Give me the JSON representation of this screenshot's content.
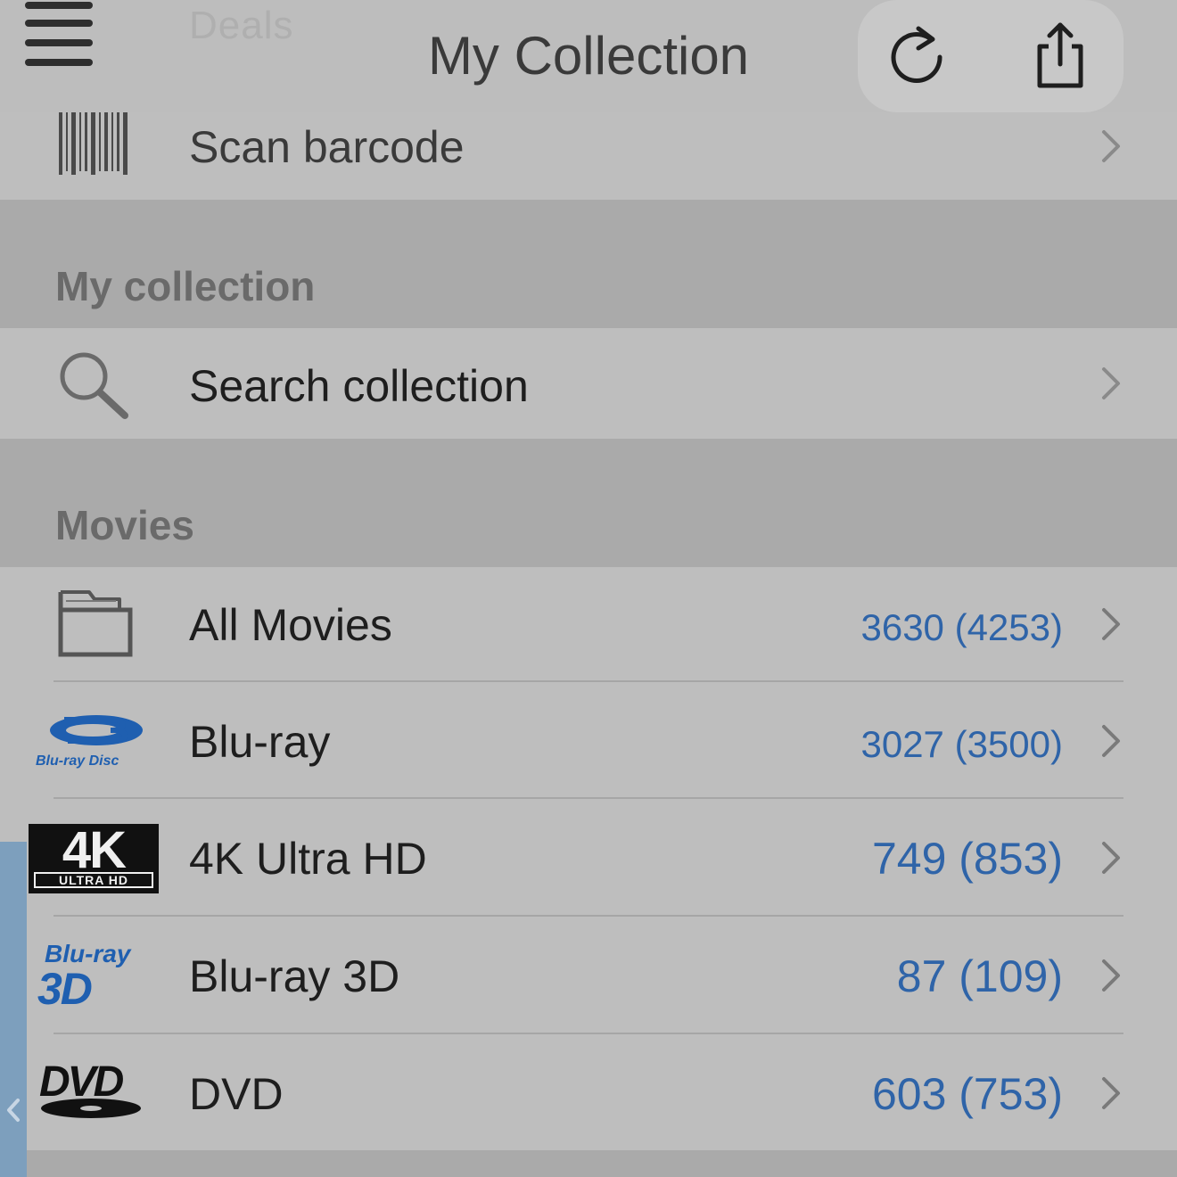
{
  "header": {
    "ghost_tab": "Deals",
    "title": "My Collection",
    "icons": {
      "menu": "menu-icon",
      "refresh": "refresh-icon",
      "share": "share-icon"
    }
  },
  "scan_row": {
    "label": "Scan barcode",
    "icon": "barcode-icon"
  },
  "sections": {
    "my_collection": "My collection",
    "movies": "Movies"
  },
  "search_row": {
    "label": "Search collection",
    "icon": "search-icon"
  },
  "movies": [
    {
      "label": "All Movies",
      "count": "3630 (4253)",
      "icon": "folder-icon"
    },
    {
      "label": "Blu-ray",
      "count": "3027 (3500)",
      "icon": "bluray-logo"
    },
    {
      "label": "4K Ultra HD",
      "count": "749 (853)",
      "icon": "4k-ultrahd-logo"
    },
    {
      "label": "Blu-ray 3D",
      "count": "87 (109)",
      "icon": "bluray-3d-logo"
    },
    {
      "label": "DVD",
      "count": "603 (753)",
      "icon": "dvd-logo"
    }
  ],
  "logos": {
    "bluray_text": "Blu-ray Disc",
    "fourk_big": "4K",
    "fourk_small": "ULTRA HD",
    "bluray3d_top": "Blu-ray",
    "bluray3d_bottom": "3D",
    "dvd": "DVD"
  },
  "colors": {
    "count_blue": "#2f64a8",
    "background": "#aaaaaa",
    "row": "#bebebe"
  }
}
